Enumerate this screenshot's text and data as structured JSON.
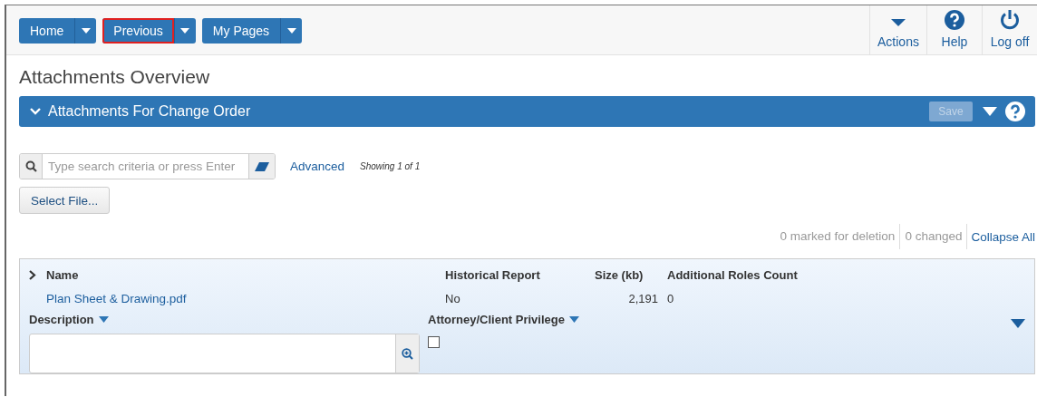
{
  "nav_buttons": [
    {
      "label": "Home",
      "selected": false
    },
    {
      "label": "Previous",
      "selected": true
    },
    {
      "label": "My Pages",
      "selected": false
    }
  ],
  "toolbar": [
    {
      "label": "Actions",
      "kind": "caret"
    },
    {
      "label": "Help",
      "kind": "help"
    },
    {
      "label": "Log off",
      "kind": "power"
    }
  ],
  "page_title": "Attachments Overview",
  "section": {
    "title": "Attachments For Change Order",
    "save_label": "Save",
    "save_disabled": true
  },
  "search": {
    "placeholder": "Type search criteria or press Enter",
    "advanced": "Advanced",
    "showing": "Showing 1 of 1"
  },
  "select_file": "Select File...",
  "status": {
    "marked": "0 marked for deletion",
    "changed": "0 changed",
    "collapse": "Collapse All"
  },
  "grid": {
    "columns": [
      "Name",
      "Historical Report",
      "Size (kb)",
      "Additional Roles Count"
    ],
    "row": {
      "name": "Plan Sheet & Drawing.pdf",
      "historical_report": "No",
      "size": "2,191",
      "roles_count": "0"
    },
    "description_label": "Description",
    "privilege_label": "Attorney/Client Privilege",
    "privilege_checked": false
  }
}
